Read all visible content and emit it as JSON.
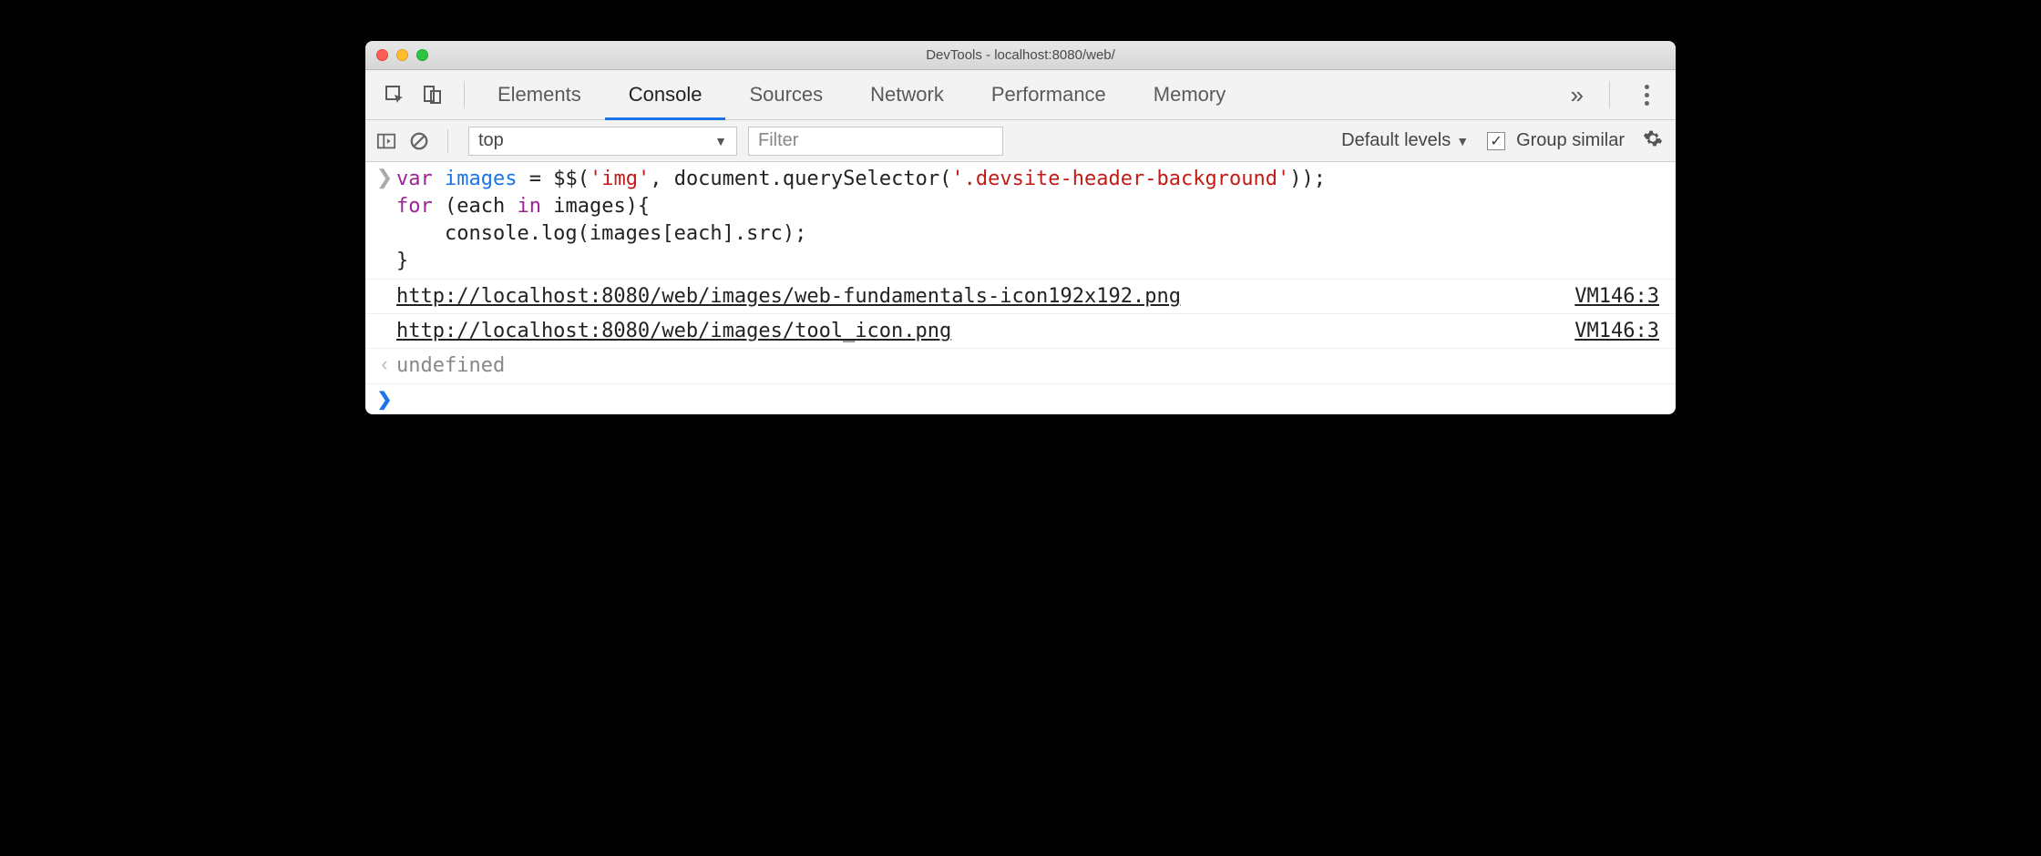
{
  "window_title": "DevTools - localhost:8080/web/",
  "tabs": {
    "elements": "Elements",
    "console": "Console",
    "sources": "Sources",
    "network": "Network",
    "performance": "Performance",
    "memory": "Memory"
  },
  "toolbar": {
    "context": "top",
    "filter_placeholder": "Filter",
    "levels_label": "Default levels",
    "group_similar_label": "Group similar",
    "group_similar_checked": true
  },
  "code_tokens": {
    "var": "var",
    "images": "images",
    "eq": " = $$(",
    "str_img": "'img'",
    "comma": ", document.querySelector(",
    "str_sel": "'.devsite-header-background'",
    "close1": "));",
    "for": "for",
    "space": " (each ",
    "in": "in",
    "images_brace": " images){",
    "indent_console": "    console.log(images[each].src);",
    "close_brace": "}"
  },
  "logs": [
    {
      "url": "http://localhost:8080/web/images/web-fundamentals-icon192x192.png",
      "src": "VM146:3"
    },
    {
      "url": "http://localhost:8080/web/images/tool_icon.png",
      "src": "VM146:3"
    }
  ],
  "return_value": "undefined"
}
